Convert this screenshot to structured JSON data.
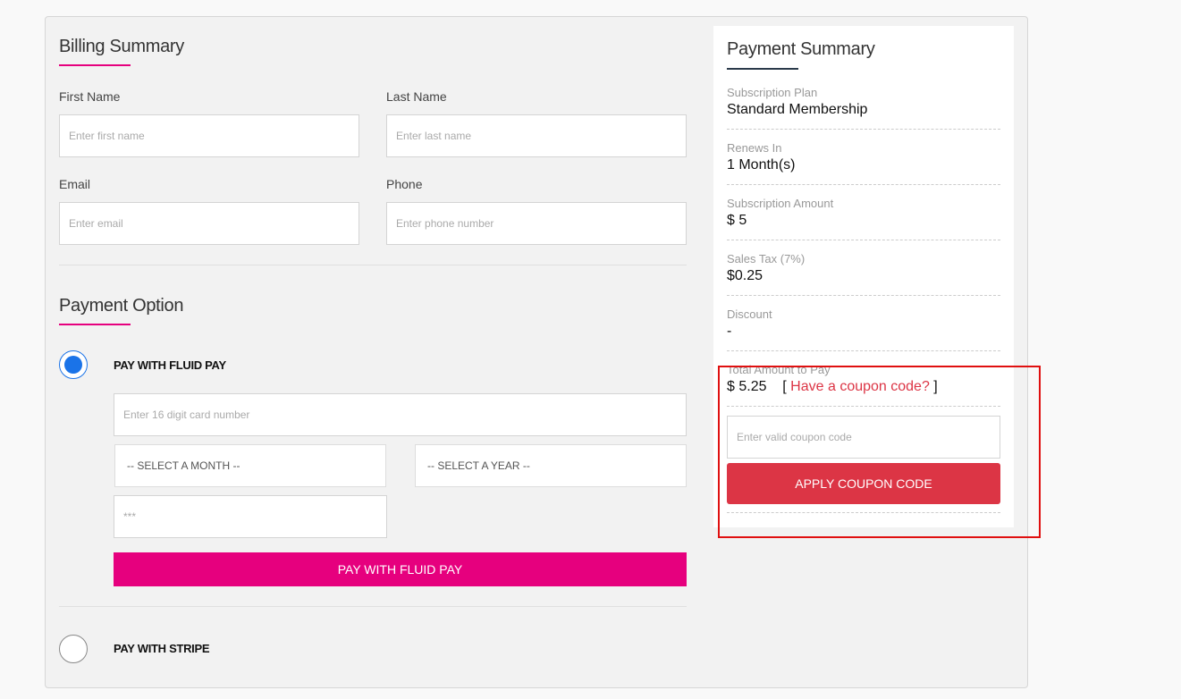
{
  "billing": {
    "title": "Billing Summary",
    "first_name_label": "First Name",
    "first_name_placeholder": "Enter first name",
    "last_name_label": "Last Name",
    "last_name_placeholder": "Enter last name",
    "email_label": "Email",
    "email_placeholder": "Enter email",
    "phone_label": "Phone",
    "phone_placeholder": "Enter phone number"
  },
  "payment_option": {
    "title": "Payment Option",
    "fluid_pay_label": "PAY WITH FLUID PAY",
    "card_placeholder": "Enter 16 digit card number",
    "month_select": "-- SELECT A MONTH --",
    "year_select": "-- SELECT A YEAR --",
    "cvv_placeholder": "***",
    "pay_button": "PAY WITH FLUID PAY",
    "stripe_label": "PAY WITH STRIPE"
  },
  "summary": {
    "title": "Payment Summary",
    "plan_label": "Subscription Plan",
    "plan_value": "Standard Membership",
    "renews_label": "Renews In",
    "renews_value": "1 Month(s)",
    "amount_label": "Subscription Amount",
    "amount_value": "$ 5",
    "tax_label": "Sales Tax (7%)",
    "tax_value": "$0.25",
    "discount_label": "Discount",
    "discount_value": "-",
    "total_label": "Total Amount to Pay",
    "total_value": "$ 5.25",
    "coupon_open": "[",
    "coupon_link": "Have a coupon code?",
    "coupon_close": "]",
    "coupon_placeholder": "Enter valid coupon code",
    "apply_button": "APPLY COUPON CODE"
  },
  "colors": {
    "accent_pink": "#e6007e",
    "radio_blue": "#1a73e8",
    "apply_red": "#dc3545",
    "highlight_red": "#e01010"
  }
}
